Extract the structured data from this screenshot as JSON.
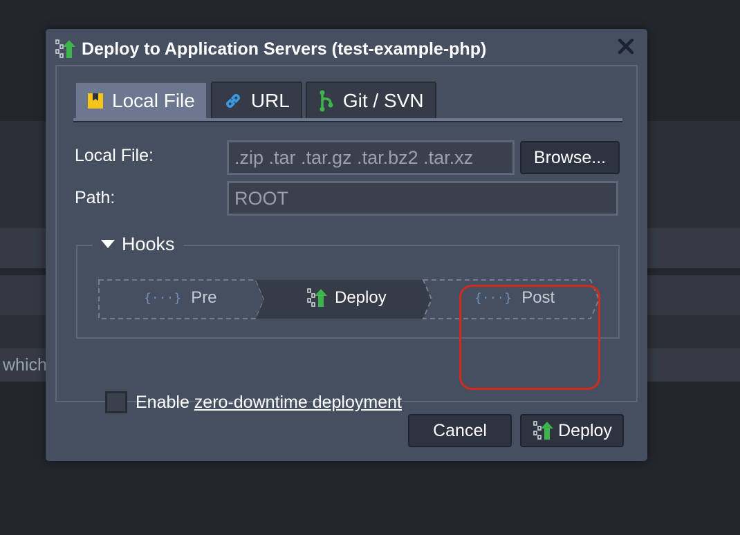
{
  "background": {
    "partial_text": "which"
  },
  "dialog": {
    "title": "Deploy to Application Servers (test-example-php)",
    "title_icon": "deploy-arrow-icon",
    "close_icon": "close-icon",
    "tabs": [
      {
        "label": "Local File",
        "icon": "archive-icon",
        "active": true
      },
      {
        "label": "URL",
        "icon": "link-icon",
        "active": false
      },
      {
        "label": "Git / SVN",
        "icon": "git-branch-icon",
        "active": false
      }
    ],
    "local_file": {
      "label": "Local File:",
      "placeholder": ".zip .tar .tar.gz .tar.bz2 .tar.xz",
      "browse_label": "Browse..."
    },
    "path": {
      "label": "Path:",
      "placeholder": "ROOT"
    },
    "hooks": {
      "legend": "Hooks",
      "steps": [
        {
          "label": "Pre",
          "icon": "code-braces-icon"
        },
        {
          "label": "Deploy",
          "icon": "deploy-arrow-icon"
        },
        {
          "label": "Post",
          "icon": "code-braces-icon"
        }
      ]
    },
    "zdt": {
      "prefix": "Enable ",
      "link": "zero-downtime deployment",
      "checked": false
    },
    "buttons": {
      "cancel": "Cancel",
      "deploy": "Deploy"
    }
  },
  "colors": {
    "dialog_bg": "#464f60",
    "accent_green": "#3db54a",
    "highlight_red": "#d22b1e",
    "link_blue": "#3a9ae6",
    "archive_yellow": "#f5c518"
  }
}
